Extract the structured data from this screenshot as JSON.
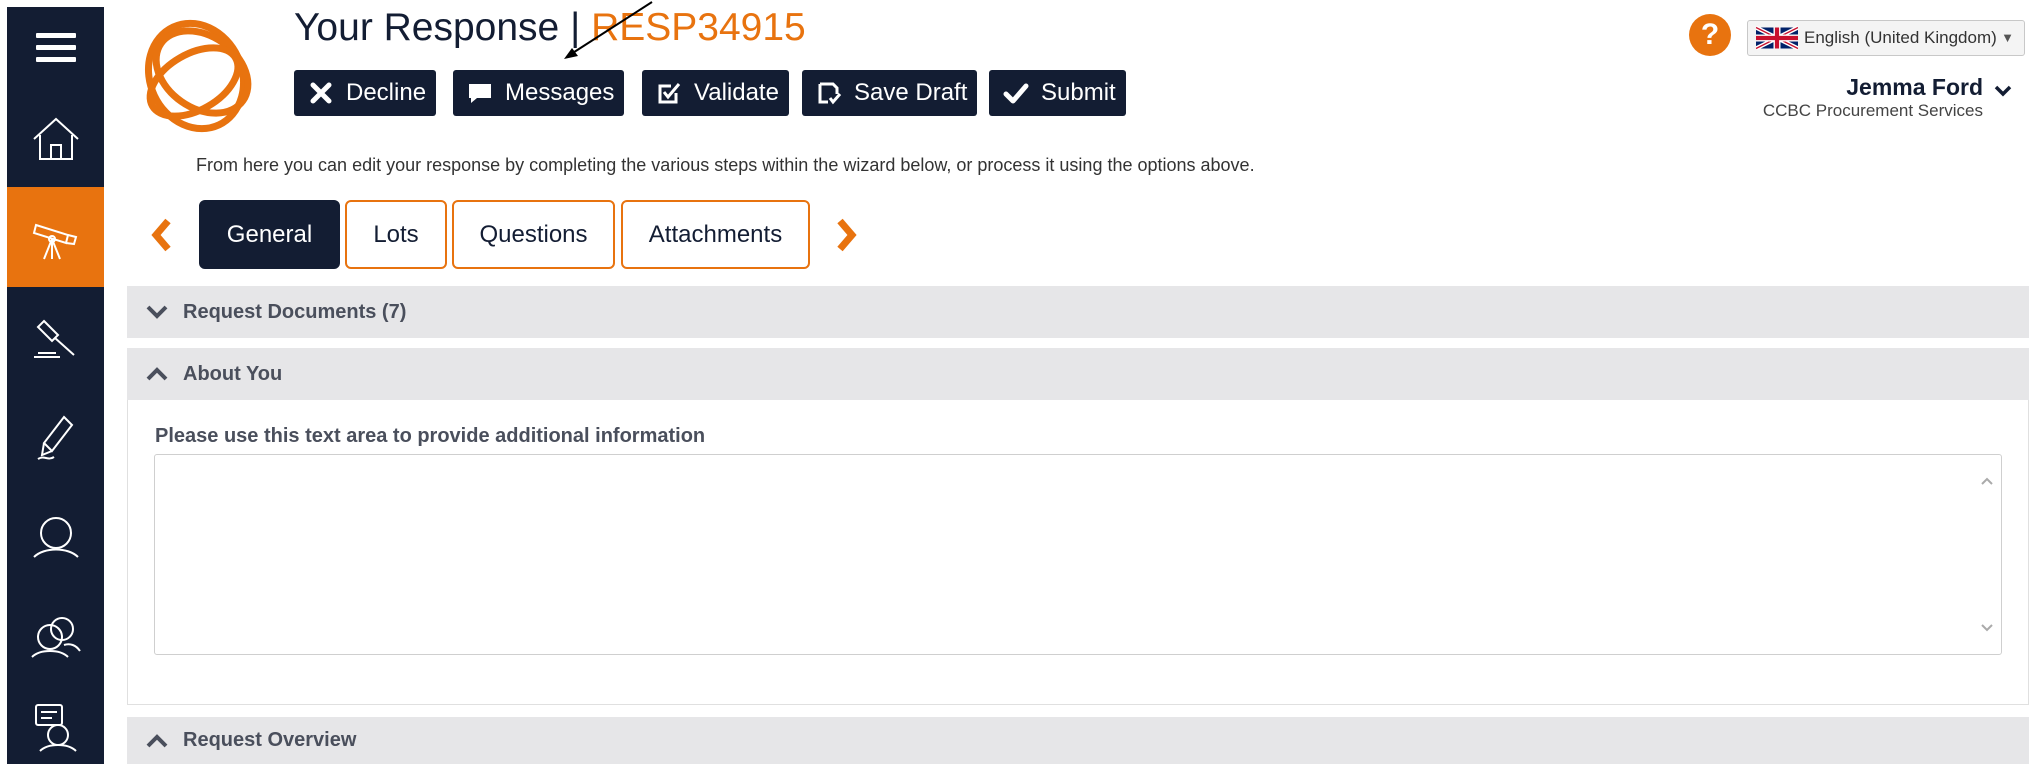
{
  "header": {
    "title_prefix": "Your Response | ",
    "title_ref": "RESP34915",
    "help_glyph": "?",
    "language": "English (United Kingdom)",
    "user_name": "Jemma Ford",
    "user_org": "CCBC Procurement Services",
    "help_text": "From here you can edit your response by completing the various steps within the wizard below, or process it using the options above."
  },
  "actions": {
    "decline": "Decline",
    "messages": "Messages",
    "validate": "Validate",
    "save_draft": "Save Draft",
    "submit": "Submit"
  },
  "sidebar": {
    "items": [
      {
        "icon": "menu-icon"
      },
      {
        "icon": "home-icon"
      },
      {
        "icon": "telescope-icon",
        "active": true
      },
      {
        "icon": "gavel-icon"
      },
      {
        "icon": "pen-icon"
      },
      {
        "icon": "user-icon"
      },
      {
        "icon": "users-icon"
      },
      {
        "icon": "user-message-icon"
      }
    ]
  },
  "tabs": {
    "general": "General",
    "lots": "Lots",
    "questions": "Questions",
    "attachments": "Attachments"
  },
  "sections": {
    "request_documents": "Request Documents (7)",
    "about_you": "About You",
    "request_overview": "Request Overview"
  },
  "about_you": {
    "field_label": "Please use this text area to provide additional information",
    "field_value": ""
  },
  "colors": {
    "navy": "#131d33",
    "orange": "#e8730f",
    "section_bg": "#e6e6e8"
  }
}
